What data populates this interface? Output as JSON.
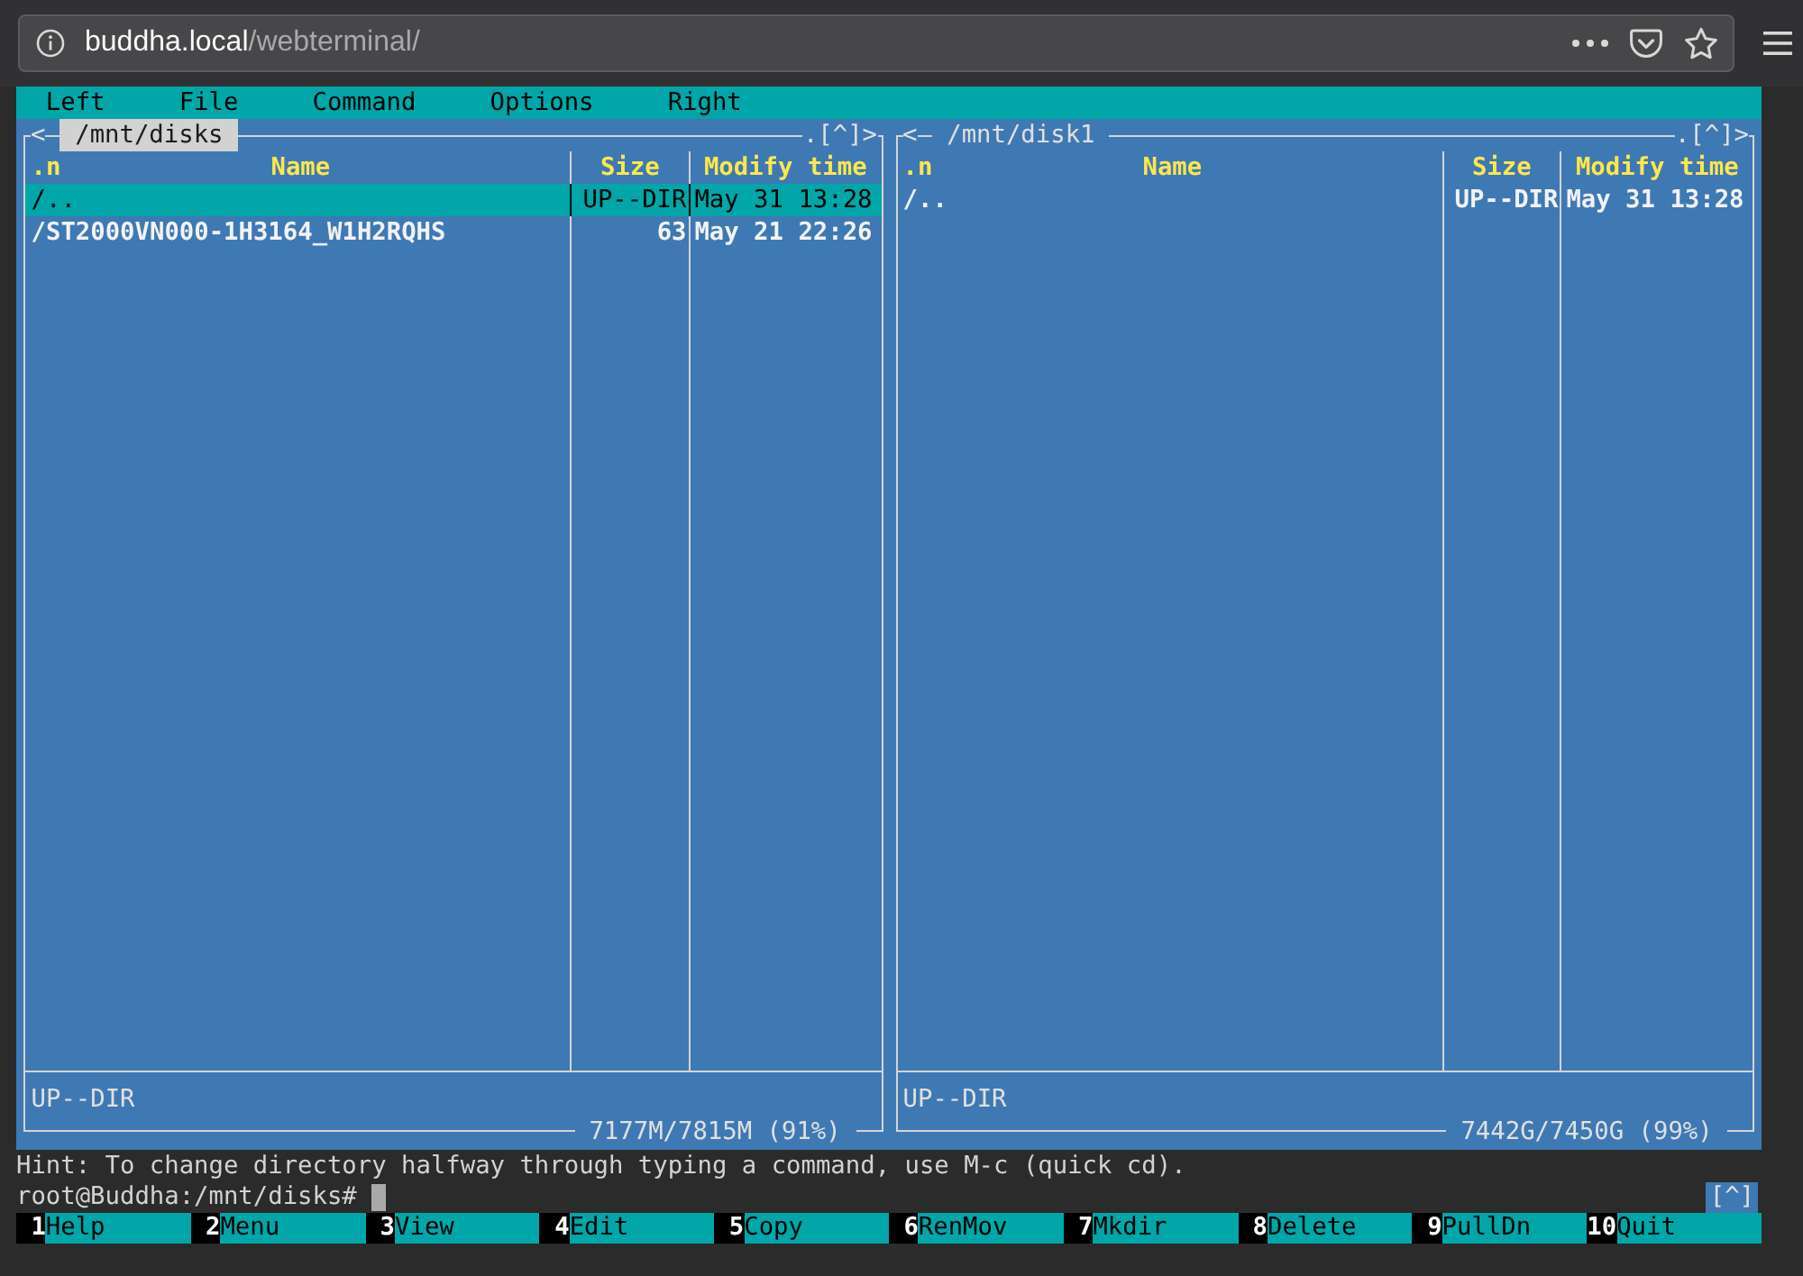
{
  "browser": {
    "url_host": "buddha.local",
    "url_path": "/webterminal/"
  },
  "menu_bar": [
    "Left",
    "File",
    "Command",
    "Options",
    "Right"
  ],
  "panels": [
    {
      "active": true,
      "back_arrow": "<",
      "path": "/mnt/disks",
      "history": ".[^]>",
      "columns": {
        "sort": ".n",
        "name": "Name",
        "size": "Size",
        "modified": "Modify time"
      },
      "rows": [
        {
          "name": "/..",
          "size": "UP--DIR",
          "modified": "May 31 13:28",
          "selected": true
        },
        {
          "name": "/ST2000VN000-1H3164_W1H2RQHS",
          "size": "63",
          "modified": "May 21 22:26",
          "selected": false
        }
      ],
      "mini_status": "UP--DIR",
      "free_space": "7177M/7815M (91%)"
    },
    {
      "active": false,
      "back_arrow": "<",
      "path": "/mnt/disk1",
      "history": ".[^]>",
      "columns": {
        "sort": ".n",
        "name": "Name",
        "size": "Size",
        "modified": "Modify time"
      },
      "rows": [
        {
          "name": "/..",
          "size": "UP--DIR",
          "modified": "May 31 13:28",
          "selected": false
        }
      ],
      "mini_status": "UP--DIR",
      "free_space": "7442G/7450G (99%)"
    }
  ],
  "hint": "Hint: To change directory halfway through typing a command, use M-c (quick cd).",
  "prompt": "root@Buddha:/mnt/disks#",
  "history_toggle": "[^]",
  "function_keys": [
    {
      "key": "1",
      "label": "Help"
    },
    {
      "key": "2",
      "label": "Menu"
    },
    {
      "key": "3",
      "label": "View"
    },
    {
      "key": "4",
      "label": "Edit"
    },
    {
      "key": "5",
      "label": "Copy"
    },
    {
      "key": "6",
      "label": "RenMov"
    },
    {
      "key": "7",
      "label": "Mkdir"
    },
    {
      "key": "8",
      "label": "Delete"
    },
    {
      "key": "9",
      "label": "PullDn"
    },
    {
      "key": "10",
      "label": "Quit"
    }
  ]
}
